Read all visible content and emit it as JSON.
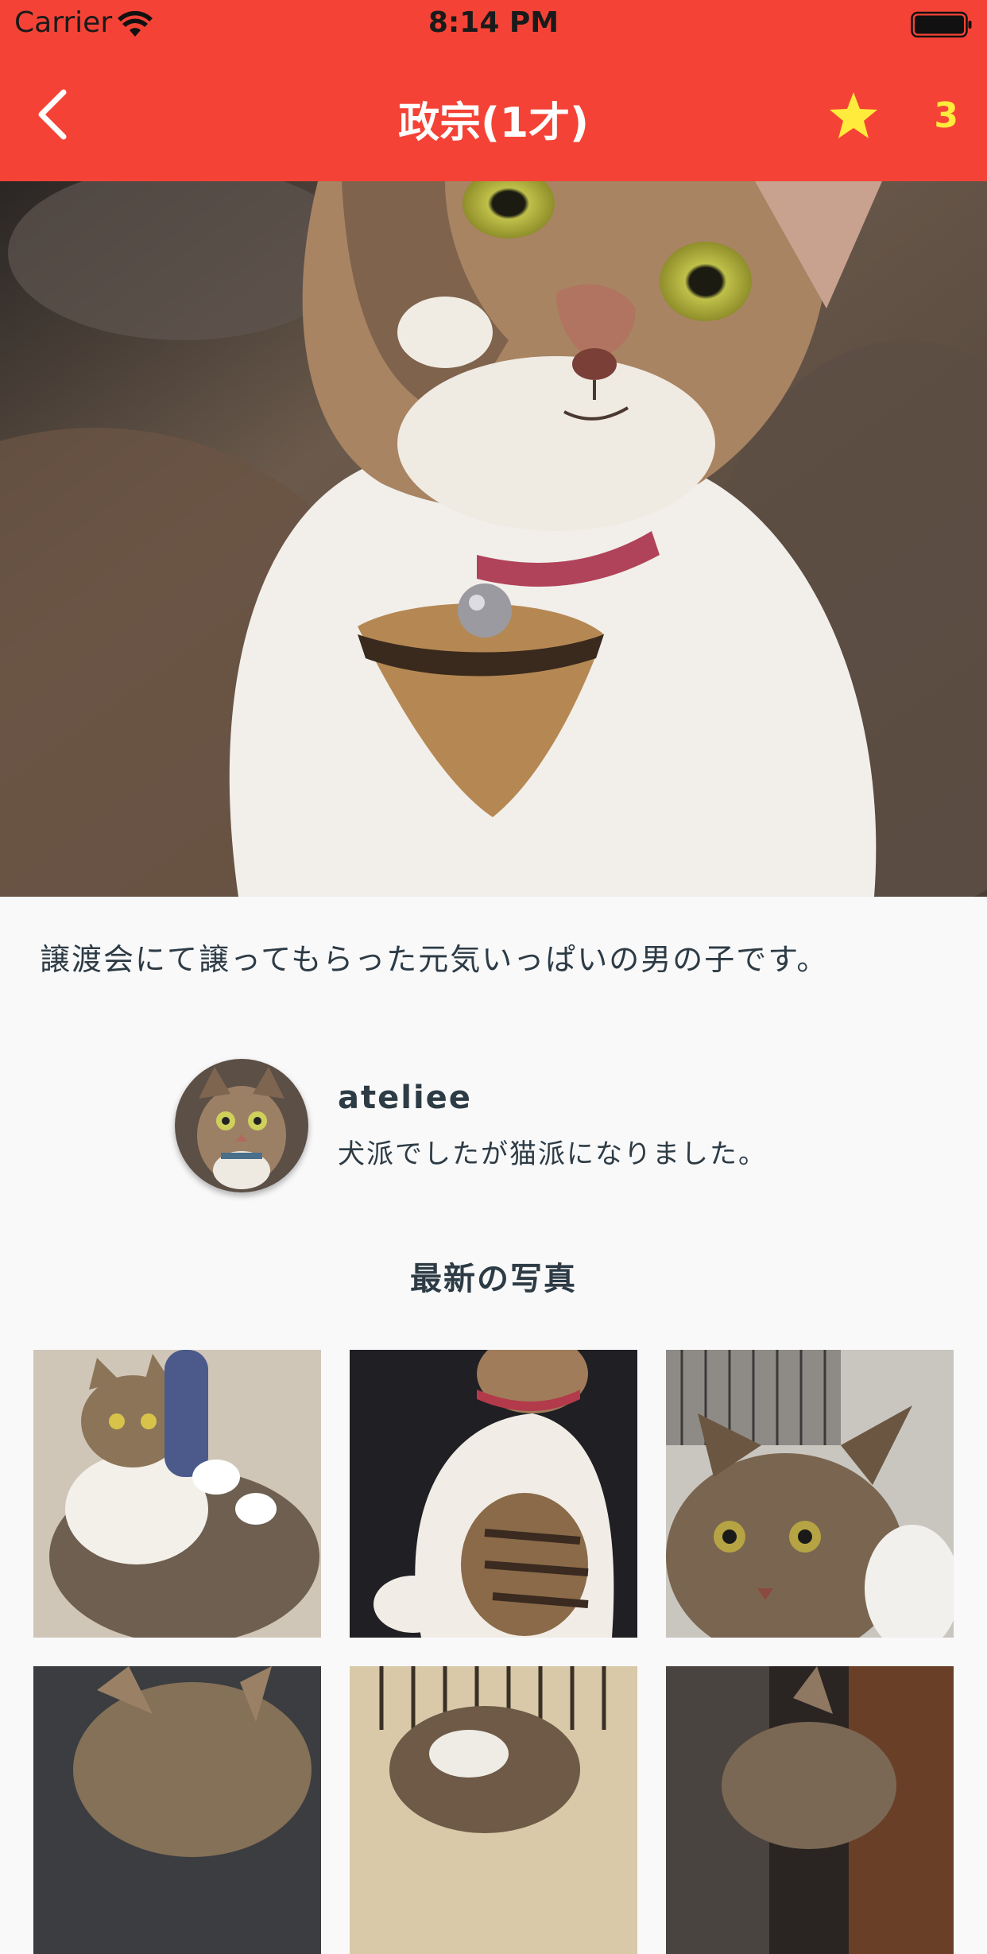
{
  "status_bar": {
    "carrier": "Carrier",
    "time": "8:14 PM"
  },
  "nav": {
    "title": "政宗(1才)",
    "back_icon": "chevron-left-icon",
    "favorite_icon": "star-icon",
    "favorite_count": "3"
  },
  "colors": {
    "app_bar": "#f44336",
    "star": "#ffeb3b",
    "background": "#f9f9fa",
    "text": "#2d3b45"
  },
  "pet": {
    "description": "譲渡会にて譲ってもらった元気いっぱいの男の子です。"
  },
  "owner": {
    "name": "ateliee",
    "bio": "犬派でしたが猫派になりました。"
  },
  "latest_photos": {
    "title": "最新の写真"
  }
}
